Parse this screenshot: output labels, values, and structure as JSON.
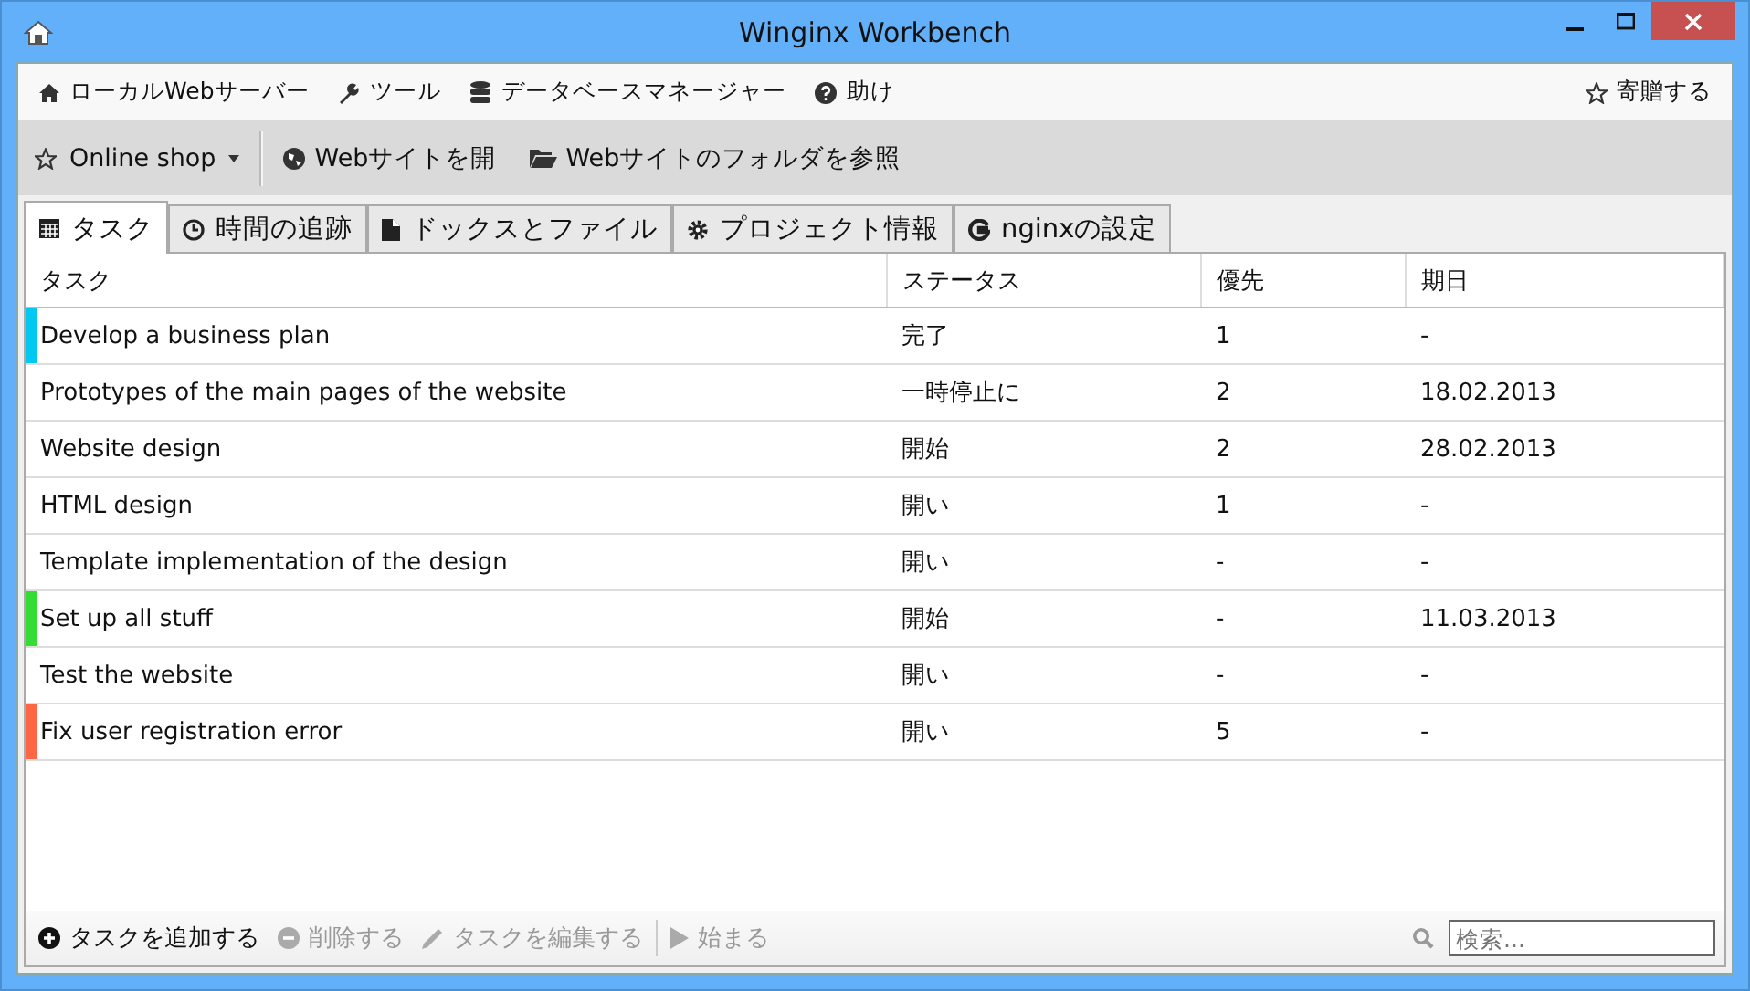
{
  "window": {
    "title": "Winginx Workbench"
  },
  "menu": [
    {
      "label": "ローカルWebサーバー"
    },
    {
      "label": "ツール"
    },
    {
      "label": "データベースマネージャー"
    },
    {
      "label": "助け"
    }
  ],
  "donate": {
    "label": "寄贈する"
  },
  "toolbar": {
    "project": "Online shop",
    "actions": [
      {
        "label": "Webサイトを開"
      },
      {
        "label": "Webサイトのフォルダを参照"
      }
    ]
  },
  "tabs": [
    {
      "label": "タスク",
      "selected": true
    },
    {
      "label": "時間の追跡",
      "selected": false
    },
    {
      "label": "ドックスとファイル",
      "selected": false
    },
    {
      "label": "プロジェクト情報",
      "selected": false
    },
    {
      "label": "nginxの設定",
      "selected": false
    }
  ],
  "table": {
    "columns": [
      "タスク",
      "ステータス",
      "優先",
      "期日"
    ],
    "rows": [
      {
        "cells": [
          "Develop a business plan",
          "完了",
          "1",
          "-"
        ],
        "color": "#00c8f0"
      },
      {
        "cells": [
          "Prototypes of the main pages of the website",
          "一時停止に",
          "2",
          "18.02.2013"
        ]
      },
      {
        "cells": [
          "Website design",
          "開始",
          "2",
          "28.02.2013"
        ]
      },
      {
        "cells": [
          "HTML design",
          "開い",
          "1",
          "-"
        ]
      },
      {
        "cells": [
          "Template implementation of the design",
          "開い",
          "-",
          "-"
        ]
      },
      {
        "cells": [
          "Set up all stuff",
          "開始",
          "-",
          "11.03.2013"
        ],
        "color": "#33dd33"
      },
      {
        "cells": [
          "Test the website",
          "開い",
          "-",
          "-"
        ]
      },
      {
        "cells": [
          "Fix user registration error",
          "開い",
          "5",
          "-"
        ],
        "color": "#ff6644"
      }
    ]
  },
  "actions": [
    {
      "label": "タスクを追加する",
      "disabled": false
    },
    {
      "label": "削除する",
      "disabled": true
    },
    {
      "label": "タスクを編集する",
      "disabled": true
    },
    {
      "label": "始まる",
      "disabled": true
    }
  ],
  "search": {
    "placeholder": "検索..."
  }
}
